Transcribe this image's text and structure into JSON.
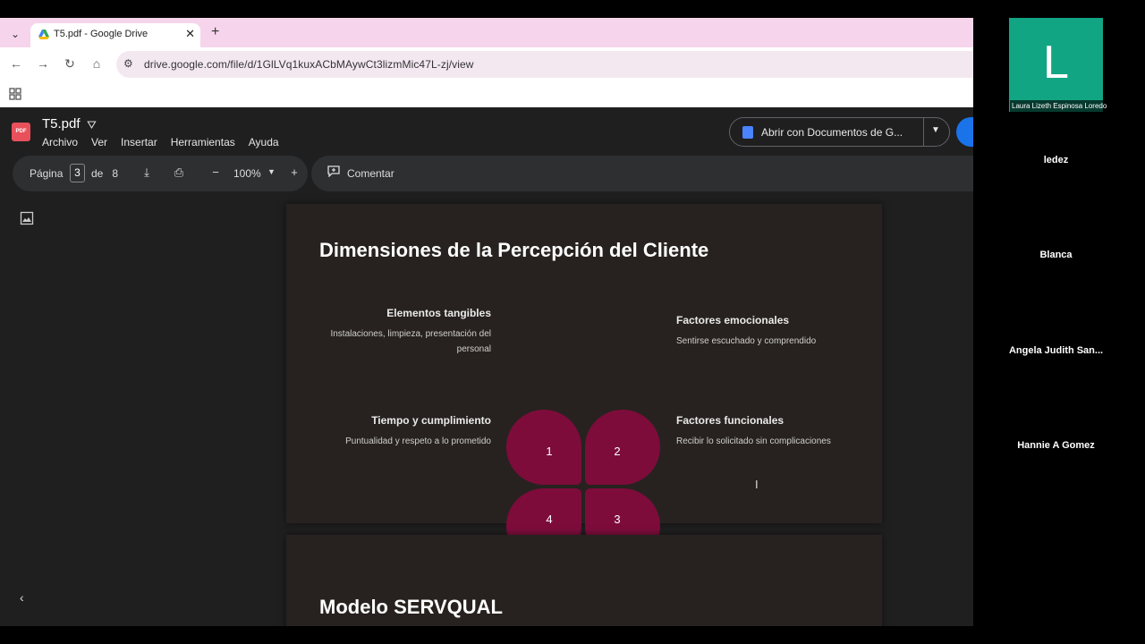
{
  "browser": {
    "tab_title": "T5.pdf - Google Drive",
    "url": "drive.google.com/file/d/1GlLVq1kuxACbMAywCt3lizmMic47L-zj/view"
  },
  "drive": {
    "file_name": "T5.pdf",
    "file_badge": "PDF",
    "menu": [
      "Archivo",
      "Ver",
      "Insertar",
      "Herramientas",
      "Ayuda"
    ],
    "open_with_label": "Abrir con Documentos de G...",
    "toolbar": {
      "page_label": "Página",
      "current_page": "3",
      "of_label": "de",
      "total_pages": "8",
      "zoom": "100%",
      "comment_label": "Comentar"
    }
  },
  "slide1": {
    "title": "Dimensiones de la Percepción del Cliente",
    "quadrants": [
      {
        "num": "1",
        "title": "Elementos tangibles",
        "desc": "Instalaciones, limpieza, presentación del personal"
      },
      {
        "num": "2",
        "title": "Factores emocionales",
        "desc": "Sentirse escuchado y comprendido"
      },
      {
        "num": "3",
        "title": "Factores funcionales",
        "desc": "Recibir lo solicitado sin complicaciones"
      },
      {
        "num": "4",
        "title": "Tiempo y cumplimiento",
        "desc": "Puntualidad y respeto a lo prometido"
      }
    ],
    "petal_color": "#7d0c3b"
  },
  "slide2": {
    "title": "Modelo SERVQUAL"
  },
  "meeting": {
    "main_tile": {
      "letter": "L",
      "name": "Laura Lizeth Espinosa Loredo",
      "color": "#12a583"
    },
    "participants": [
      "ledez",
      "Blanca",
      "Angela Judith San...",
      "Hannie A Gomez"
    ]
  }
}
